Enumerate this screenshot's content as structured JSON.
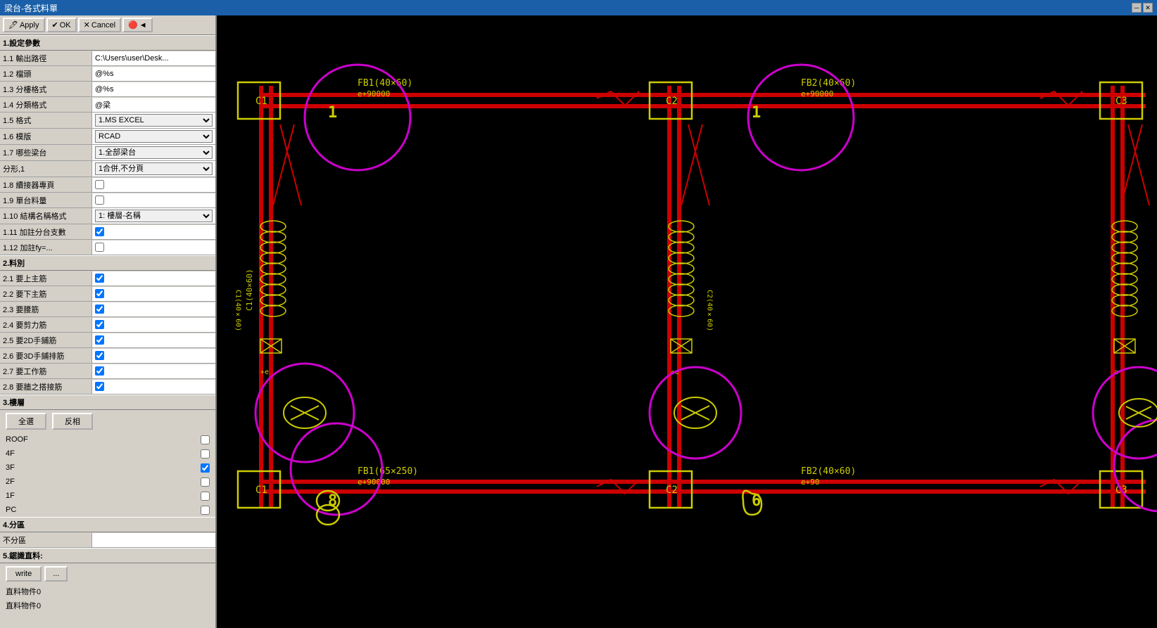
{
  "titleBar": {
    "title": "梁台-各式料單",
    "closeBtn": "✕",
    "minBtn": "─",
    "maxBtn": "□"
  },
  "toolbar": {
    "applyLabel": "Apply",
    "okLabel": "OK",
    "cancelLabel": "Cancel",
    "backLabel": "◄"
  },
  "sections": {
    "s1": {
      "header": "1.設定參數",
      "fields": [
        {
          "label": "1.1 輸出路徑",
          "value": "C:\\Users\\user\\Desk...",
          "type": "text",
          "name": "output-path"
        },
        {
          "label": "1.2 檔頭",
          "value": "@%s",
          "type": "text",
          "name": "file-header"
        },
        {
          "label": "1.3 分樓格式",
          "value": "@%s",
          "type": "text",
          "name": "floor-format"
        },
        {
          "label": "1.4 分類格式",
          "value": "@梁",
          "type": "text",
          "name": "category-format"
        },
        {
          "label": "1.5 格式",
          "value": "1.MS EXCEL",
          "type": "select",
          "options": [
            "1.MS EXCEL"
          ],
          "name": "format-select"
        },
        {
          "label": "1.6 模版",
          "value": "RCAD",
          "type": "select",
          "options": [
            "RCAD"
          ],
          "name": "template-select"
        },
        {
          "label": "1.7 哪些梁台",
          "value": "1.全部梁台",
          "type": "select",
          "options": [
            "1.全部梁台"
          ],
          "name": "beam-select"
        },
        {
          "label": "分形,1",
          "value": "1合併,不分頁",
          "type": "select",
          "options": [
            "1合併,不分頁"
          ],
          "name": "merge-select"
        },
        {
          "label": "1.8 續接器專頁",
          "value": "",
          "type": "checkbox",
          "checked": false,
          "name": "connector-page"
        },
        {
          "label": "1.9 單台料量",
          "value": "",
          "type": "checkbox",
          "checked": false,
          "name": "single-qty"
        },
        {
          "label": "1.10 結構名稱格式",
          "value": "1: 樓層-名稱",
          "type": "select",
          "options": [
            "1: 樓層-名稱"
          ],
          "name": "struct-name-format"
        },
        {
          "label": "1.11 加註分台支數",
          "value": "",
          "type": "checkbox",
          "checked": true,
          "name": "note-support"
        },
        {
          "label": "1.12 加註fy=...",
          "value": "",
          "type": "checkbox",
          "checked": false,
          "name": "note-fy"
        }
      ]
    },
    "s2": {
      "header": "2.料別",
      "fields": [
        {
          "label": "2.1 要上主筋",
          "value": "",
          "type": "checkbox",
          "checked": true,
          "name": "top-main-bar"
        },
        {
          "label": "2.2 要下主筋",
          "value": "",
          "type": "checkbox",
          "checked": true,
          "name": "bot-main-bar"
        },
        {
          "label": "2.3 要腰筋",
          "value": "",
          "type": "checkbox",
          "checked": true,
          "name": "waist-bar"
        },
        {
          "label": "2.4 要剪力筋",
          "value": "",
          "type": "checkbox",
          "checked": true,
          "name": "shear-bar"
        },
        {
          "label": "2.5 要2D手鋪筋",
          "value": "",
          "type": "checkbox",
          "checked": true,
          "name": "2d-hand-bar"
        },
        {
          "label": "2.6 要3D手鋪排筋",
          "value": "",
          "type": "checkbox",
          "checked": true,
          "name": "3d-hand-bar"
        },
        {
          "label": "2.7 要工作筋",
          "value": "",
          "type": "checkbox",
          "checked": true,
          "name": "work-bar"
        },
        {
          "label": "2.8 要牆之搭接筋",
          "value": "",
          "type": "checkbox",
          "checked": true,
          "name": "wall-lap-bar"
        }
      ]
    },
    "s3": {
      "header": "3.樓層",
      "selectAllBtn": "全選",
      "invertBtn": "反相",
      "floors": [
        {
          "label": "ROOF",
          "checked": false,
          "name": "floor-roof"
        },
        {
          "label": "4F",
          "checked": false,
          "name": "floor-4f"
        },
        {
          "label": "3F",
          "checked": true,
          "name": "floor-3f"
        },
        {
          "label": "2F",
          "checked": false,
          "name": "floor-2f"
        },
        {
          "label": "1F",
          "checked": false,
          "name": "floor-1f"
        },
        {
          "label": "PC",
          "checked": false,
          "name": "floor-pc"
        }
      ]
    },
    "s4": {
      "header": "4.分區",
      "fields": [
        {
          "label": "不分區",
          "value": "",
          "type": "text",
          "name": "no-zone"
        }
      ]
    },
    "s5": {
      "header": "5.鋸識直料:",
      "writeBtn": "write",
      "dotsBtn": "...",
      "objects": [
        {
          "label": "直料物件0",
          "name": "straight-obj-0"
        },
        {
          "label": "直料物件0",
          "name": "straight-obj-1"
        }
      ]
    }
  },
  "cad": {
    "beamLabels": [
      "FB1(40×60)",
      "FB2(40×60)",
      "FB1(65×250)",
      "FB2(40×60)"
    ],
    "colLabels": [
      "C1",
      "C2",
      "C3"
    ],
    "annotations": [
      "e+90000",
      "e+90"
    ],
    "numbers": [
      "1",
      "1",
      "8",
      "6"
    ]
  }
}
